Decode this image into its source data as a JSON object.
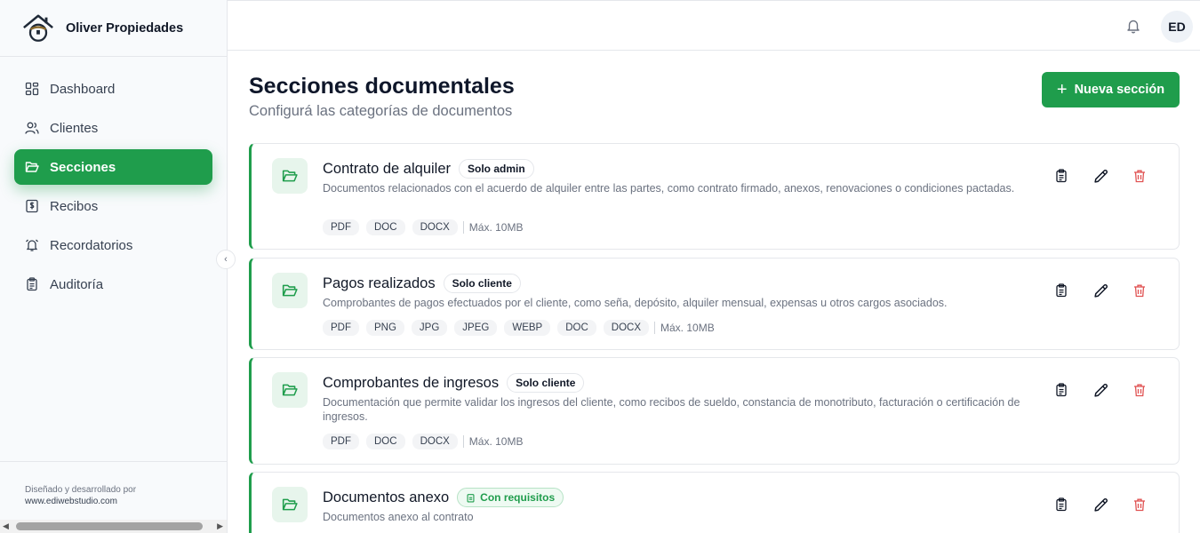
{
  "brand": {
    "name": "Oliver Propiedades"
  },
  "nav": {
    "items": [
      {
        "label": "Dashboard",
        "icon": "dashboard-icon"
      },
      {
        "label": "Clientes",
        "icon": "users-icon"
      },
      {
        "label": "Secciones",
        "icon": "folder-open-icon",
        "active": true
      },
      {
        "label": "Recibos",
        "icon": "receipt-icon"
      },
      {
        "label": "Recordatorios",
        "icon": "alarm-icon"
      },
      {
        "label": "Auditoría",
        "icon": "clipboard-icon"
      }
    ]
  },
  "credits": {
    "line1": "Diseñado y desarrollado por",
    "url": "www.ediwebstudio.com"
  },
  "header": {
    "avatar_initials": "ED"
  },
  "page": {
    "title": "Secciones documentales",
    "subtitle": "Configurá las categorías de documentos",
    "new_button_label": "Nueva sección"
  },
  "sections": [
    {
      "title": "Contrato de alquiler",
      "badge": "Solo admin",
      "description": "Documentos relacionados con el acuerdo de alquiler entre las partes, como contrato firmado, anexos, renovaciones o condiciones pactadas.",
      "formats": [
        "PDF",
        "DOC",
        "DOCX"
      ],
      "max_size": "Máx. 10MB"
    },
    {
      "title": "Pagos realizados",
      "badge": "Solo cliente",
      "description": "Comprobantes de pagos efectuados por el cliente, como seña, depósito, alquiler mensual, expensas u otros cargos asociados.",
      "formats": [
        "PDF",
        "PNG",
        "JPG",
        "JPEG",
        "WEBP",
        "DOC",
        "DOCX"
      ],
      "max_size": "Máx. 10MB"
    },
    {
      "title": "Comprobantes de ingresos",
      "badge": "Solo cliente",
      "description": "Documentación que permite validar los ingresos del cliente, como recibos de sueldo, constancia de monotributo, facturación o certificación de ingresos.",
      "formats": [
        "PDF",
        "DOC",
        "DOCX"
      ],
      "max_size": "Máx. 10MB"
    },
    {
      "title": "Documentos anexo",
      "badge": "Con requisitos",
      "description": "Documentos anexo al contrato"
    }
  ],
  "colors": {
    "accent": "#1f9d4c",
    "danger": "#e05252"
  }
}
